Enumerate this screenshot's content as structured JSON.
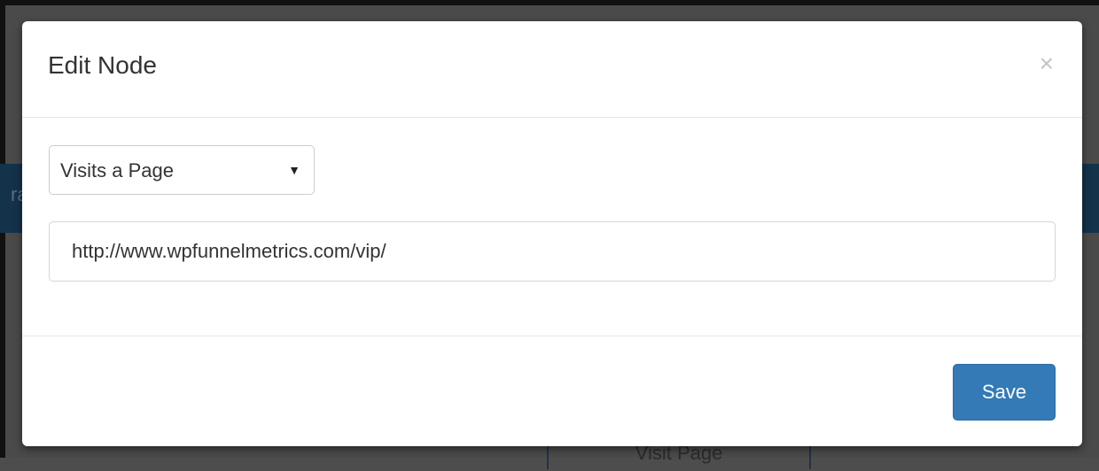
{
  "background": {
    "band_text": "ra",
    "node_label": "Visit Page"
  },
  "modal": {
    "title": "Edit Node",
    "close_glyph": "×",
    "select": {
      "selected": "Visits a Page",
      "arrow": "▼"
    },
    "url_input": {
      "value": "http://www.wpfunnelmetrics.com/vip/"
    },
    "save_label": "Save"
  },
  "colors": {
    "primary": "#337ab7",
    "band": "#14324a",
    "overlay": "#4a4a4a"
  }
}
